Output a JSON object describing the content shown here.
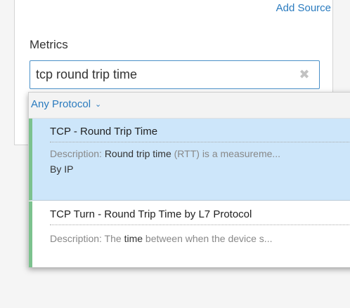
{
  "panel": {
    "add_source_label": "Add Source",
    "metrics_label": "Metrics"
  },
  "search": {
    "value": "tcp round trip time",
    "clear_icon": "✖"
  },
  "dropdown": {
    "protocol_filter": "Any Protocol",
    "results": [
      {
        "title": "TCP - Round Trip Time",
        "desc_prefix": "Description: ",
        "desc_match_1": "Round trip time",
        "desc_rest_1": " (RTT) is a measureme...",
        "byline": "By IP"
      },
      {
        "title": "TCP Turn - Round Trip Time by L7 Protocol",
        "desc_prefix": "Description: The ",
        "desc_match_1": "time",
        "desc_rest_1": " between when the device s..."
      }
    ]
  },
  "colors": {
    "accent": "#2a7bbf",
    "selected_row": "#cde6fa",
    "row_marker": "#7cc28e"
  }
}
